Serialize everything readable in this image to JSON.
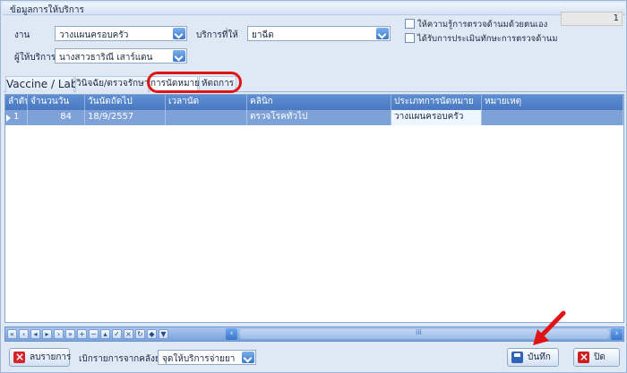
{
  "window": {
    "title": "ข้อมูลการให้บริการ"
  },
  "form": {
    "work_label": "งาน",
    "work_value": "วางแผนครอบครัว",
    "service_label": "บริการที่ให้",
    "service_value": "ยาฉีด",
    "provider_label": "ผู้ให้บริการ",
    "provider_value": "นางสาวธาริณี เสาร์แดน",
    "check1_label": "ให้ความรู้การตรวจด้านมด้วยตนเอง",
    "check2_label": "ได้รับการประเมินทักษะการตรวจด้านม",
    "counter_value": "1"
  },
  "tabs": [
    {
      "label": "Vaccine / Lab"
    },
    {
      "label": "วินิจฉัย/ตรวจรักษา"
    },
    {
      "label": "การนัดหมาย"
    },
    {
      "label": "หัตถการ"
    }
  ],
  "table": {
    "headers": [
      "ลำดับ",
      "จำนวนวัน",
      "วันนัดถัดไป",
      "เวลานัด",
      "คลินิก",
      "ประเภทการนัดหมาย",
      "หมายเหตุ"
    ],
    "rows": [
      [
        "1",
        "84",
        "18/9/2557",
        "",
        "ตรวจโรคทั่วไป",
        "วางแผนครอบครัว",
        ""
      ]
    ]
  },
  "navigator": {
    "icons": [
      "first-icon",
      "prev-page-icon",
      "prev-icon",
      "next-icon",
      "next-page-icon",
      "last-icon",
      "add-icon",
      "delete-icon",
      "edit-icon",
      "post-icon",
      "cancel-icon",
      "refresh-icon",
      "bookmark-icon",
      "filter-icon"
    ],
    "scroll_center": "iii"
  },
  "bottom": {
    "delete_label": "ลบรายการ",
    "open_label": "เบิกรายการจากคลังย่อย",
    "dispense_value": "จุดให้บริการจ่ายยา",
    "save_label": "บันทึก",
    "close_label": "ปิด"
  },
  "colors": {
    "accent": "#4a78c0",
    "highlight_oval": "#e01414",
    "arrow": "#e01414"
  }
}
